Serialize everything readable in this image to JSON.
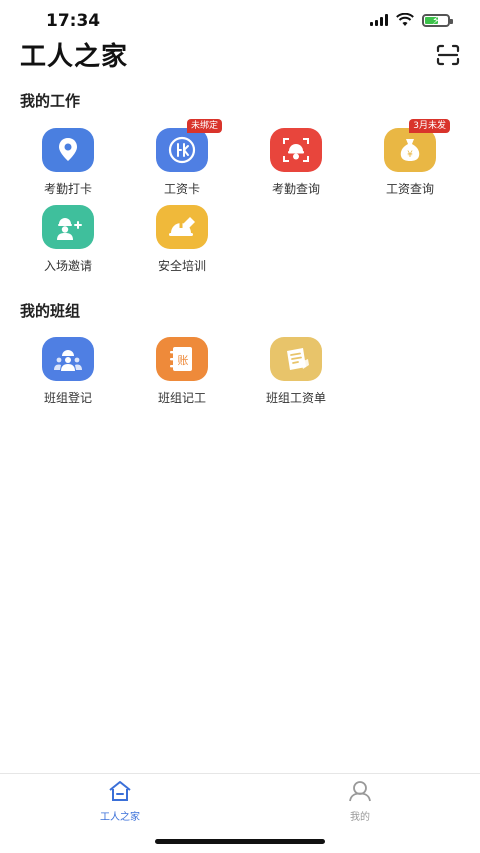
{
  "status_bar": {
    "time": "17:34"
  },
  "header": {
    "title": "工人之家",
    "scan_icon": "scan-icon"
  },
  "sections": {
    "work": {
      "title": "我的工作",
      "items": [
        {
          "label": "考勤打卡",
          "icon": "location-pin-icon",
          "color": "#4a7fe0"
        },
        {
          "label": "工资卡",
          "icon": "bank-card-icon",
          "color": "#4f7fe3",
          "badge": "未绑定"
        },
        {
          "label": "考勤查询",
          "icon": "face-scan-icon",
          "color": "#e8453c"
        },
        {
          "label": "工资查询",
          "icon": "money-bag-icon",
          "color": "#e9b744",
          "badge": "3月未发"
        },
        {
          "label": "入场邀请",
          "icon": "worker-invite-icon",
          "color": "#3fbf9c"
        },
        {
          "label": "安全培训",
          "icon": "safety-helmet-icon",
          "color": "#f0b93a"
        }
      ]
    },
    "team": {
      "title": "我的班组",
      "items": [
        {
          "label": "班组登记",
          "icon": "team-icon",
          "color": "#4f7fe3"
        },
        {
          "label": "班组记工",
          "icon": "ledger-icon",
          "color": "#ee8a3a",
          "glyph": "账"
        },
        {
          "label": "班组工资单",
          "icon": "payslip-icon",
          "color": "#e8c46a"
        }
      ]
    }
  },
  "tab_bar": {
    "tabs": [
      {
        "label": "工人之家",
        "active": true,
        "color": "#3a6fd8"
      },
      {
        "label": "我的",
        "active": false,
        "color": "#999999"
      }
    ]
  }
}
